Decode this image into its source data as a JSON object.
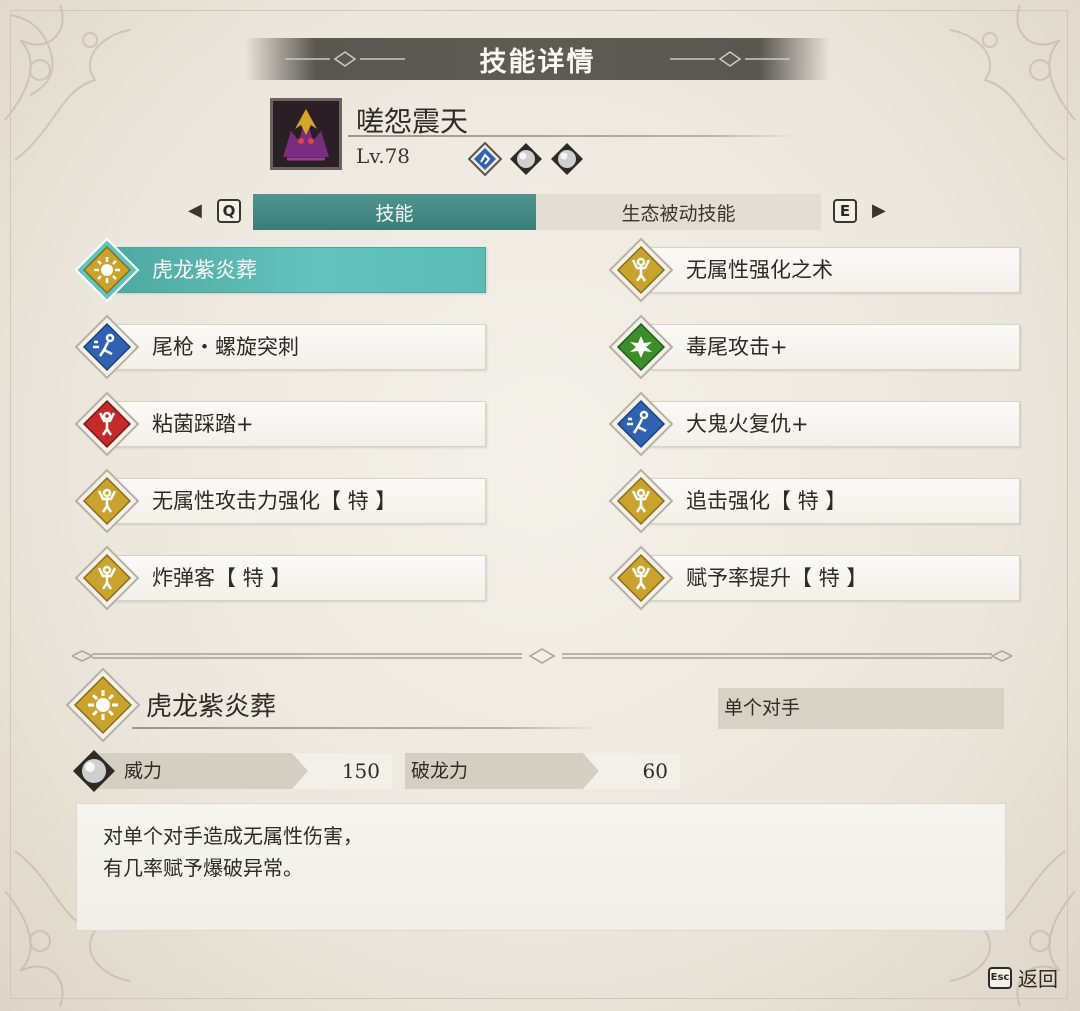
{
  "header": {
    "title": "技能详情"
  },
  "monster": {
    "name": "嗟怨震天",
    "level": "Lv.78",
    "gene_slots": [
      {
        "type": "blue-skill",
        "color": "#2f62b0"
      },
      {
        "type": "empty",
        "color": "#b7b7b7"
      },
      {
        "type": "empty",
        "color": "#b7b7b7"
      }
    ]
  },
  "tabs": {
    "prev_key": "Q",
    "next_key": "E",
    "prev_arrow": "◀",
    "next_arrow": "▶",
    "items": [
      {
        "label": "技能",
        "active": true
      },
      {
        "label": "生态被动技能",
        "active": false
      }
    ]
  },
  "skills_left": [
    {
      "label": "虎龙紫炎葬",
      "icon": "burst-icon",
      "color": "#c9a32e",
      "active": true
    },
    {
      "label": "尾枪・螺旋突刺",
      "icon": "technical-kick-icon",
      "color": "#2f62b0",
      "active": false
    },
    {
      "label": "粘菌踩踏+",
      "icon": "power-strike-icon",
      "color": "#c42a2a",
      "active": false
    },
    {
      "label": "无属性攻击力强化【 特 】",
      "icon": "passive-buff-icon",
      "color": "#c9a32e",
      "active": false
    },
    {
      "label": "炸弹客【 特 】",
      "icon": "passive-buff-icon",
      "color": "#c9a32e",
      "active": false
    }
  ],
  "skills_right": [
    {
      "label": "无属性强化之术",
      "icon": "passive-buff-icon",
      "color": "#c9a32e"
    },
    {
      "label": "毒尾攻击+",
      "icon": "poison-burst-icon",
      "color": "#3c8e2a"
    },
    {
      "label": "大鬼火复仇+",
      "icon": "technical-kick-icon",
      "color": "#2f62b0"
    },
    {
      "label": "追击强化【 特 】",
      "icon": "passive-buff-icon",
      "color": "#c9a32e"
    },
    {
      "label": "赋予率提升【 特 】",
      "icon": "passive-buff-icon",
      "color": "#c9a32e"
    }
  ],
  "detail": {
    "name": "虎龙紫炎葬",
    "icon": "burst-icon",
    "target": "单个对手",
    "power_label": "威力",
    "power_value": "150",
    "kinship_label": "破龙力",
    "kinship_value": "60",
    "description_lines": [
      "对单个对手造成无属性伤害，",
      "有几率赋予爆破异常。"
    ]
  },
  "footer": {
    "esc_key": "Esc",
    "back_label": "返回"
  }
}
